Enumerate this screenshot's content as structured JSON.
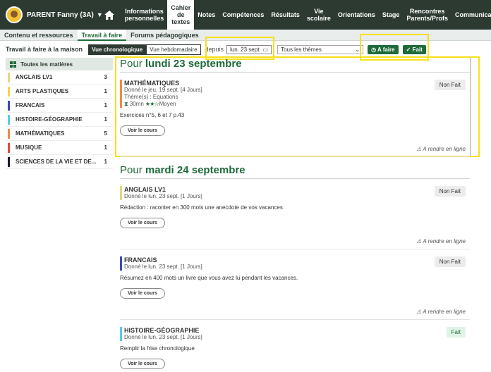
{
  "user": {
    "name": "PARENT Fanny (3A)"
  },
  "menu": [
    {
      "label": "Informations\npersonnelles",
      "active": false
    },
    {
      "label": "Cahier\nde textes",
      "active": true
    },
    {
      "label": "Notes",
      "active": false
    },
    {
      "label": "Compétences",
      "active": false
    },
    {
      "label": "Résultats",
      "active": false
    },
    {
      "label": "Vie\nscolaire",
      "active": false
    },
    {
      "label": "Orientations",
      "active": false
    },
    {
      "label": "Stage",
      "active": false
    },
    {
      "label": "Rencontres\nParents/Profs",
      "active": false
    },
    {
      "label": "Communication",
      "active": false
    }
  ],
  "subtabs": [
    "Contenu et ressources",
    "Travail à faire",
    "Forums pédagogiques"
  ],
  "toolbar": {
    "title": "Travail à faire à la maison",
    "view_chrono": "Vue chronologique",
    "view_weekly": "Vue hebdomadaire",
    "depuis": "depuis",
    "date": "lun. 23 sept.",
    "themes": "Tous les thèmes",
    "afaire": "A faire",
    "fait": "Fait"
  },
  "sidebar": {
    "all_label": "Toutes les matières",
    "items": [
      {
        "label": "ANGLAIS LV1",
        "count": "3",
        "color": "#e6d77a"
      },
      {
        "label": "ARTS PLASTIQUES",
        "count": "1",
        "color": "#f3d44c"
      },
      {
        "label": "FRANCAIS",
        "count": "1",
        "color": "#3b4ab8"
      },
      {
        "label": "HISTOIRE-GÉOGRAPHIE",
        "count": "1",
        "color": "#5ec8e6"
      },
      {
        "label": "MATHÉMATIQUES",
        "count": "5",
        "color": "#ef8a4b"
      },
      {
        "label": "MUSIQUE",
        "count": "1",
        "color": "#e04a3f"
      },
      {
        "label": "SCIENCES DE LA VIE ET DE...",
        "count": "1",
        "color": "#1a1a3a"
      }
    ]
  },
  "days": [
    {
      "prefix": "Pour ",
      "date": "lundi 23 septembre",
      "tasks": [
        {
          "subject": "MATHÉMATIQUES",
          "color": "#ef8a4b",
          "given": "Donné le jeu. 19 sept. [4 Jours]",
          "theme": "Thème(s) : Equations",
          "duration": "30mn",
          "level": "Moyen",
          "desc": "Exercices n°5, 6 et 7 p.43",
          "status": "Non Fait",
          "done": false,
          "button": "Voir le cours",
          "online": "A rendre en ligne"
        }
      ]
    },
    {
      "prefix": "Pour ",
      "date": "mardi 24 septembre",
      "tasks": [
        {
          "subject": "ANGLAIS LV1",
          "color": "#e6d77a",
          "given": "Donné le lun. 23 sept. [1 Jours]",
          "desc": "Rédaction : raconter en 300 mots une anecdote de vos vacances",
          "status": "Non Fait",
          "done": false,
          "button": "Voir le cours",
          "online": "A rendre en ligne"
        },
        {
          "subject": "FRANCAIS",
          "color": "#3b4ab8",
          "given": "Donné le lun. 23 sept. [1 Jours]",
          "desc": "Résumez en 400 mots un livre que vous avez lu pendant les vacances.",
          "status": "Non Fait",
          "done": false,
          "button": "Voir le cours",
          "online": "A rendre en ligne"
        },
        {
          "subject": "HISTOIRE-GÉOGRAPHIE",
          "color": "#5ec8e6",
          "given": "Donné le lun. 23 sept. [1 Jours]",
          "desc": "Remplir la frise chronologique",
          "status": "Fait",
          "done": true,
          "button": "Voir le cours"
        }
      ]
    }
  ]
}
